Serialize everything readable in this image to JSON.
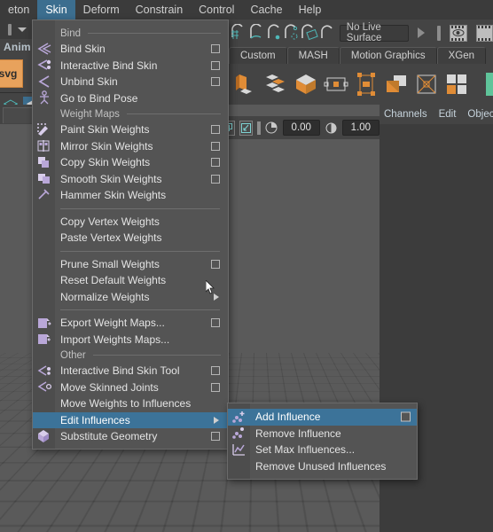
{
  "menubar": {
    "items": [
      {
        "label": "eton",
        "active": false
      },
      {
        "label": "Skin",
        "active": true
      },
      {
        "label": "Deform",
        "active": false
      },
      {
        "label": "Constrain",
        "active": false
      },
      {
        "label": "Control",
        "active": false
      },
      {
        "label": "Cache",
        "active": false
      },
      {
        "label": "Help",
        "active": false
      }
    ],
    "accent_color": "#3c6e8f"
  },
  "left_strip": {
    "menuset_label": "Anim",
    "shelf_item_label": "svg"
  },
  "toolbar": {
    "live_surface_value": "No Live Surface",
    "snap_icons": [
      "snap-to-grid-icon",
      "snap-to-curve-icon",
      "snap-to-point-icon",
      "snap-to-projected-center-icon",
      "snap-to-view-plane-icon",
      "make-live-icon"
    ]
  },
  "shelf": {
    "tabs": [
      {
        "label": "Custom"
      },
      {
        "label": "MASH"
      },
      {
        "label": "Motion Graphics"
      },
      {
        "label": "XGen"
      }
    ],
    "icons": [
      "mash-network-icon",
      "mash-distribute-icon",
      "mash-cube-icon",
      "mash-placer-icon",
      "mash-instancer-icon",
      "mash-fold-icon",
      "mash-bounding-box-icon",
      "mash-grid-icon",
      "mash-checker-icon"
    ]
  },
  "channel_box": {
    "tabs": [
      "Channels",
      "Edit",
      "Object"
    ]
  },
  "numeric_row": {
    "value_min": "0.00",
    "value_max": "1.00"
  },
  "skin_menu": {
    "sections": [
      {
        "title": "Bind",
        "items": [
          {
            "label": "Bind Skin",
            "option_box": true,
            "icon": "bind-skin-icon"
          },
          {
            "label": "Interactive Bind Skin",
            "option_box": true,
            "icon": "interactive-bind-skin-icon"
          },
          {
            "label": "Unbind Skin",
            "option_box": true,
            "icon": "unbind-skin-icon"
          },
          {
            "label": "Go to Bind Pose",
            "option_box": false,
            "icon": "bind-pose-icon"
          }
        ]
      },
      {
        "title": "Weight Maps",
        "items": [
          {
            "label": "Paint Skin Weights",
            "option_box": true,
            "icon": "paint-skin-weights-icon"
          },
          {
            "label": "Mirror Skin Weights",
            "option_box": true,
            "icon": "mirror-skin-weights-icon"
          },
          {
            "label": "Copy Skin Weights",
            "option_box": true,
            "icon": "copy-skin-weights-icon"
          },
          {
            "label": "Smooth Skin Weights",
            "option_box": true,
            "icon": "smooth-skin-weights-icon"
          },
          {
            "label": "Hammer Skin Weights",
            "option_box": false,
            "icon": "hammer-skin-weights-icon"
          }
        ]
      },
      {
        "title": "",
        "items": [
          {
            "label": "Copy Vertex Weights",
            "option_box": false,
            "icon": ""
          },
          {
            "label": "Paste Vertex Weights",
            "option_box": false,
            "icon": ""
          }
        ]
      },
      {
        "title": "",
        "items": [
          {
            "label": "Prune Small Weights",
            "option_box": true,
            "icon": ""
          },
          {
            "label": "Reset Default Weights",
            "option_box": false,
            "icon": ""
          },
          {
            "label": "Normalize Weights",
            "option_box": false,
            "submenu": true,
            "icon": ""
          }
        ]
      },
      {
        "title": "",
        "items": [
          {
            "label": "Export Weight Maps...",
            "option_box": true,
            "icon": "export-weight-maps-icon"
          },
          {
            "label": "Import Weights Maps...",
            "option_box": false,
            "icon": "import-weight-maps-icon"
          }
        ]
      },
      {
        "title": "Other",
        "items": [
          {
            "label": "Interactive Bind Skin Tool",
            "option_box": true,
            "icon": "interactive-bind-skin-tool-icon"
          },
          {
            "label": "Move Skinned Joints",
            "option_box": true,
            "icon": "move-skinned-joints-icon"
          },
          {
            "label": "Move Weights to Influences",
            "option_box": false,
            "icon": ""
          },
          {
            "label": "Edit Influences",
            "option_box": false,
            "submenu": true,
            "highlighted": true,
            "icon": ""
          },
          {
            "label": "Substitute Geometry",
            "option_box": true,
            "icon": "substitute-geometry-icon"
          }
        ]
      }
    ]
  },
  "edit_influences_submenu": {
    "items": [
      {
        "label": "Add Influence",
        "option_box": true,
        "highlighted": true,
        "icon": "add-influence-icon"
      },
      {
        "label": "Remove Influence",
        "option_box": false,
        "icon": "remove-influence-icon"
      },
      {
        "label": "Set Max Influences...",
        "option_box": false,
        "icon": "set-max-influences-icon"
      },
      {
        "label": "Remove Unused Influences",
        "option_box": false,
        "icon": ""
      }
    ]
  }
}
